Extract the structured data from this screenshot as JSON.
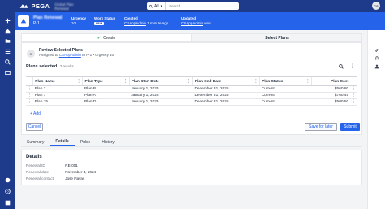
{
  "brand": {
    "logo_text": "PEGA",
    "app_name": "Global Plan Renewal"
  },
  "search": {
    "scope": "All",
    "placeholder": "Search..."
  },
  "user": {
    "initials": "CS"
  },
  "case": {
    "title": "Plan Renewal",
    "id": "P-1",
    "fields": [
      {
        "label": "Urgency",
        "value": "10"
      },
      {
        "label": "Work Status",
        "value": "NEW"
      },
      {
        "label": "Created",
        "value": "CSAppAdmin",
        "extra": "1 minute ago"
      },
      {
        "label": "Updated",
        "value": "CSAppAdmin",
        "extra": "now"
      }
    ]
  },
  "stages": [
    {
      "label": "Create",
      "done": true
    },
    {
      "label": "Select Plans",
      "active": true
    }
  ],
  "assignment": {
    "avatar": "C",
    "title": "Review Selected Plans",
    "assigned_prefix": "Assigned to",
    "assigned_to": "CSAppAdmin",
    "context": "In P-1 • Urgency 10"
  },
  "plans": {
    "title": "Plans selected",
    "count": "3 results",
    "columns": [
      "Plan Name",
      "Plan Type",
      "Plan Start Date",
      "Plan End Date",
      "Plan Status",
      "Plan Cost"
    ],
    "rows": [
      [
        "Plan 2",
        "Plan B",
        "January 1, 2025",
        "December 31, 2025",
        "Current",
        "$560.80"
      ],
      [
        "Plan 7",
        "Plan A",
        "January 1, 2025",
        "December 31, 2025",
        "Current",
        "$760.45"
      ],
      [
        "Plan 15",
        "Plan D",
        "January 1, 2025",
        "December 31, 2025",
        "Current",
        "$500.50"
      ]
    ],
    "add_label": "+ Add"
  },
  "actions": {
    "cancel": "Cancel",
    "save": "Save for later",
    "submit": "Submit"
  },
  "tabs": [
    {
      "label": "Summary"
    },
    {
      "label": "Details",
      "active": true
    },
    {
      "label": "Pulse"
    },
    {
      "label": "History"
    }
  ],
  "details": {
    "title": "Details",
    "rows": [
      {
        "label": "Renewal ID",
        "value": "RE-001"
      },
      {
        "label": "Renewal date",
        "value": "November 4, 2024"
      },
      {
        "label": "Renewal contact",
        "value": "Jose Navas"
      }
    ]
  },
  "colors": {
    "brand": "#1e3a8a",
    "header": "#2563eb",
    "accent": "#2563eb",
    "success": "#16a34a"
  },
  "icons": [
    "plus-icon",
    "home-icon",
    "folder-icon",
    "list-icon",
    "search-icon",
    "dashboard-icon",
    "grid-icon",
    "notification-icon",
    "help-icon",
    "bell-icon",
    "more-icon"
  ]
}
